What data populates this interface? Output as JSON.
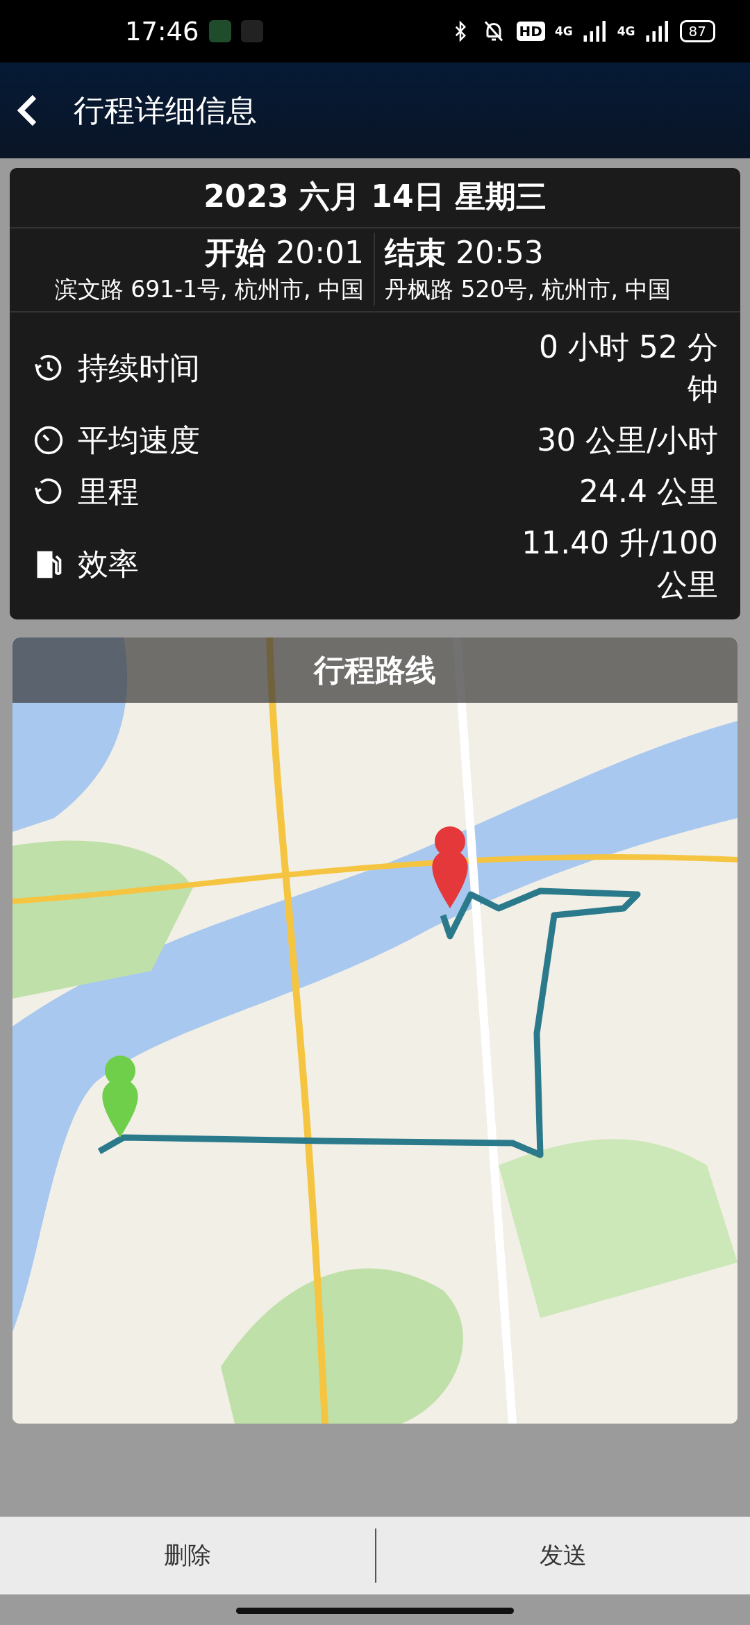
{
  "status_bar": {
    "time": "17:46",
    "hd": "HD",
    "networks": [
      "4G",
      "4G"
    ],
    "battery": "87"
  },
  "header": {
    "title": "行程详细信息"
  },
  "trip": {
    "date": "2023 六月 14日 星期三",
    "start": {
      "label": "开始",
      "time": "20:01",
      "address": "滨文路 691-1号, 杭州市, 中国"
    },
    "end": {
      "label": "结束",
      "time": "20:53",
      "address": "丹枫路 520号, 杭州市, 中国"
    },
    "stats": [
      {
        "kind": "duration",
        "label": "持续时间",
        "value": "0 小时 52 分钟"
      },
      {
        "kind": "speed",
        "label": "平均速度",
        "value": "30 公里/小时"
      },
      {
        "kind": "distance",
        "label": "里程",
        "value": "24.4 公里"
      },
      {
        "kind": "fuel",
        "label": "效率",
        "value": "11.40 升/100 公里"
      }
    ]
  },
  "map": {
    "title": "行程路线"
  },
  "actions": [
    "删除",
    "发送"
  ]
}
